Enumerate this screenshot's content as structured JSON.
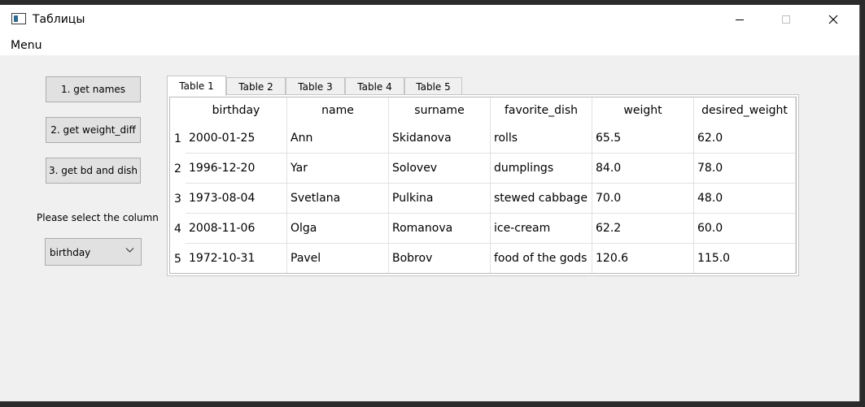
{
  "window": {
    "title": "Таблицы",
    "minimize": "—",
    "maximize": "☐",
    "close": "✕"
  },
  "menu": {
    "label": "Menu"
  },
  "buttons": {
    "get_names": "1. get names",
    "get_weight_diff": "2. get weight_diff",
    "get_bd_dish": "3. get bd and dish"
  },
  "column_select": {
    "prompt": "Please select the column",
    "selected": "birthday"
  },
  "tabs": [
    "Table 1",
    "Table 2",
    "Table 3",
    "Table 4",
    "Table 5"
  ],
  "table": {
    "headers": [
      "birthday",
      "name",
      "surname",
      "favorite_dish",
      "weight",
      "desired_weight"
    ],
    "rows": [
      {
        "num": "1",
        "cells": [
          "2000-01-25",
          "Ann",
          "Skidanova",
          "rolls",
          "65.5",
          "62.0"
        ]
      },
      {
        "num": "2",
        "cells": [
          "1996-12-20",
          "Yar",
          "Solovev",
          "dumplings",
          "84.0",
          "78.0"
        ]
      },
      {
        "num": "3",
        "cells": [
          "1973-08-04",
          "Svetlana",
          "Pulkina",
          "stewed cabbage",
          "70.0",
          "48.0"
        ]
      },
      {
        "num": "4",
        "cells": [
          "2008-11-06",
          "Olga",
          "Romanova",
          "ice-cream",
          "62.2",
          "60.0"
        ]
      },
      {
        "num": "5",
        "cells": [
          "1972-10-31",
          "Pavel",
          "Bobrov",
          "food of the gods",
          "120.6",
          "115.0"
        ]
      }
    ]
  }
}
